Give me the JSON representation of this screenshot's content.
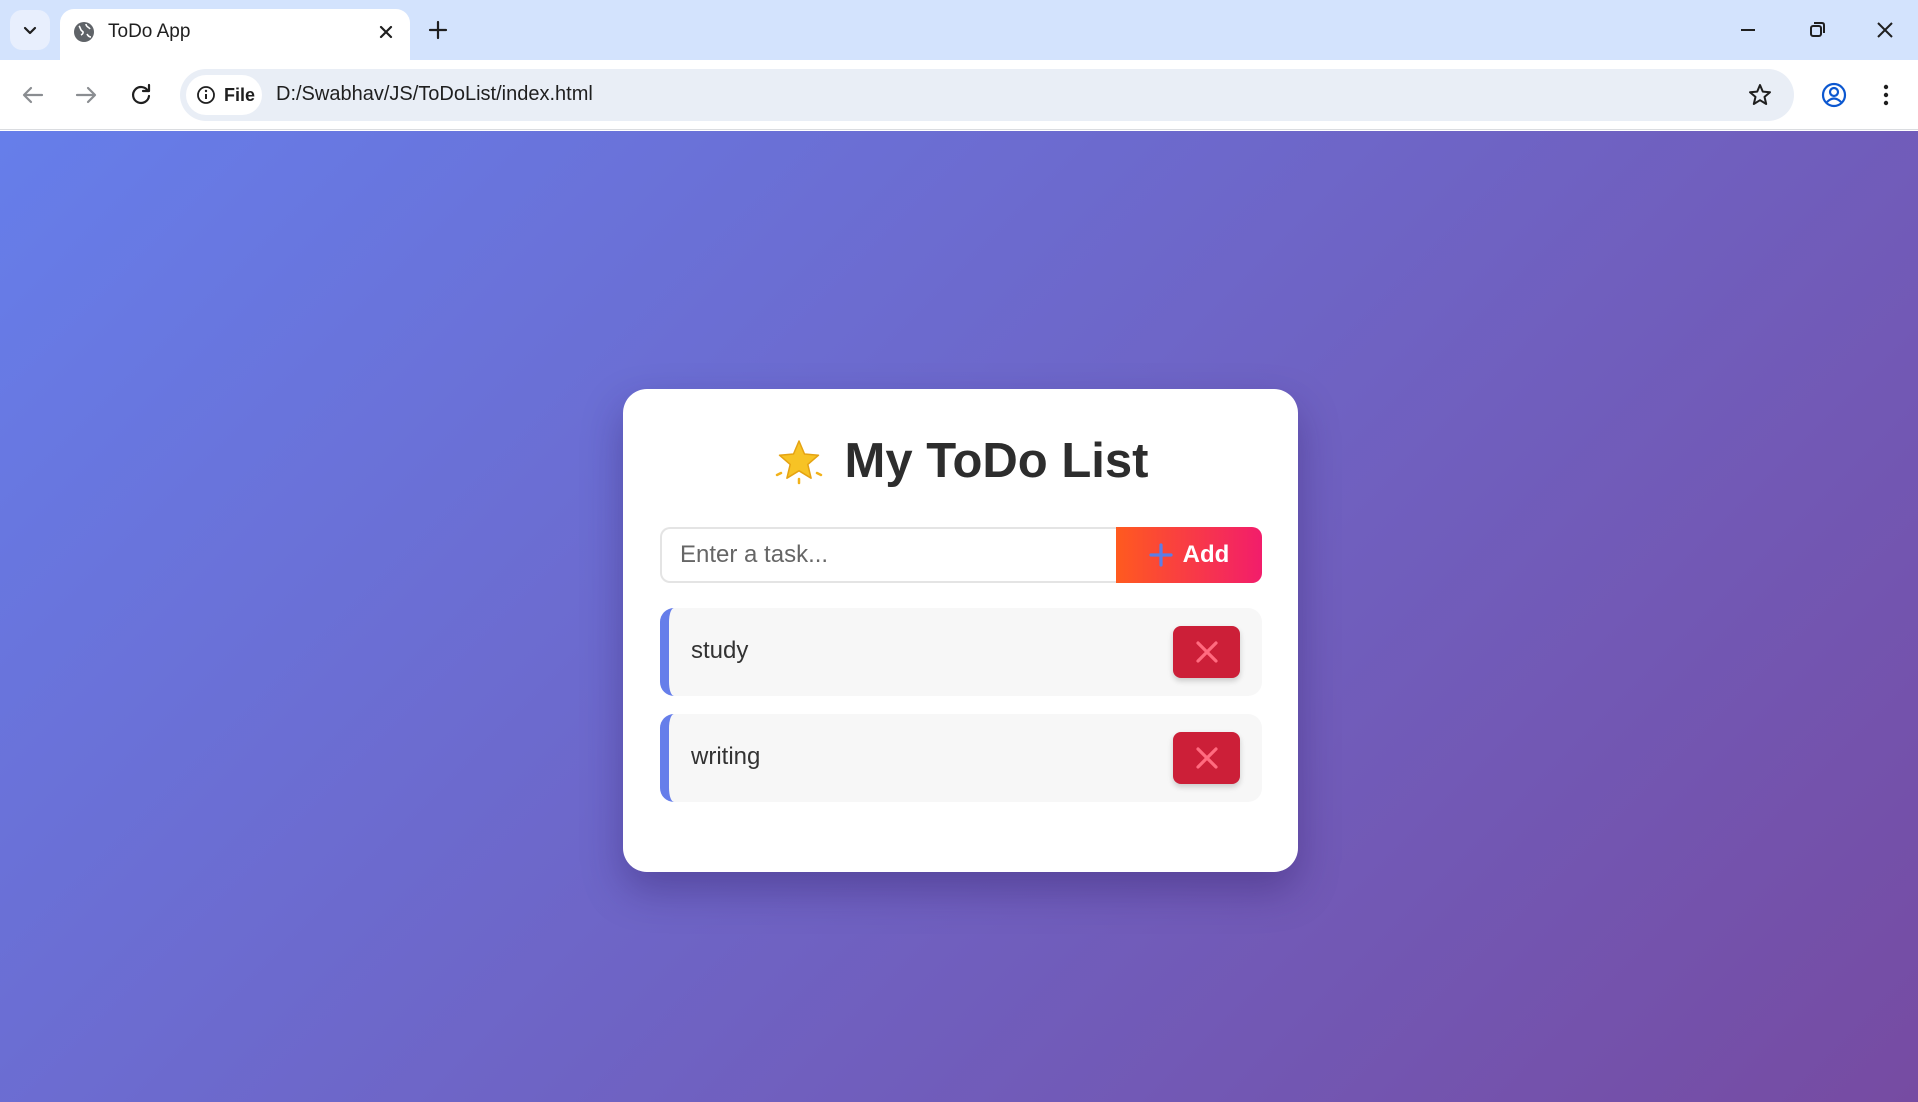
{
  "browser": {
    "tab_title": "ToDo App",
    "site_chip_label": "File",
    "url": "D:/Swabhav/JS/ToDoList/index.html",
    "icons": [
      "tab-search-icon",
      "globe-icon",
      "close-icon",
      "plus-icon",
      "minimize-icon",
      "restore-icon",
      "close-window-icon",
      "back-arrow-icon",
      "forward-arrow-icon",
      "reload-icon",
      "info-icon",
      "star-icon",
      "profile-icon",
      "kebab-menu-icon"
    ]
  },
  "app": {
    "title": "My ToDo List",
    "title_icon": "star-emoji-icon",
    "input": {
      "placeholder": "Enter a task...",
      "value": ""
    },
    "add_button": {
      "label": "Add",
      "icon": "plus-icon"
    },
    "todos": [
      {
        "text": "study",
        "delete_icon": "x-icon"
      },
      {
        "text": "writing",
        "delete_icon": "x-icon"
      }
    ],
    "colors": {
      "bg_gradient_start": "#667eea",
      "bg_gradient_end": "#764ba2",
      "add_gradient_start": "#ff5a1f",
      "add_gradient_end": "#f21d6b",
      "delete_bg": "#cc1f38",
      "item_accent": "#667eea"
    }
  }
}
